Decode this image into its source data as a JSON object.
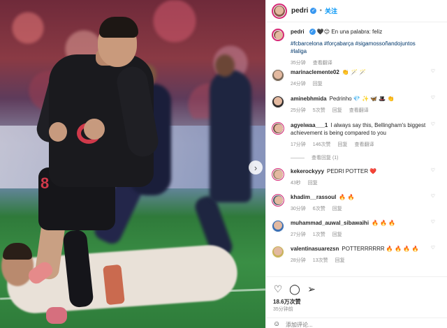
{
  "post": {
    "username": "pedri",
    "follow_label": "关注",
    "caption_text": "🖤😊 En una palabra: feliz",
    "hashtags": "#fcbarcelona #forçabarça #sigamossoñandojuntos #laliga",
    "caption_time": "35分钟",
    "caption_translate": "查看翻译",
    "jersey_number": "8",
    "likes": "18.6万次赞",
    "time_ago": "35分钟前",
    "add_comment_placeholder": "添加评论..."
  },
  "comments": [
    {
      "user": "marinaclemente02",
      "text": "👏 🪄 🪄",
      "time": "24分钟",
      "likes": "",
      "reply": "回复",
      "translate": ""
    },
    {
      "user": "aminebhmida",
      "text": "Pedrinho 💎 ✨ 🦋 🎩 👏",
      "time": "25分钟",
      "likes": "5次赞",
      "reply": "回复",
      "translate": "查看翻译"
    },
    {
      "user": "agyeiwaa___1",
      "text": "I always say this, Bellingham's biggest achievement is being compared to you",
      "time": "17分钟",
      "likes": "146次赞",
      "reply": "回复",
      "translate": "查看翻译",
      "view_replies": "查看回复 (1)"
    },
    {
      "user": "kekerockyyy",
      "text": "PEDRI POTTER ❤️",
      "time": "43秒",
      "likes": "",
      "reply": "回复",
      "translate": ""
    },
    {
      "user": "khadim__rassoul",
      "text": "🔥 🔥",
      "time": "30分钟",
      "likes": "6次赞",
      "reply": "回复",
      "translate": ""
    },
    {
      "user": "muhammad_auwal_sibawaihi",
      "text": "🔥 🔥 🔥",
      "time": "27分钟",
      "likes": "1次赞",
      "reply": "回复",
      "translate": ""
    },
    {
      "user": "valentinasuarezsn",
      "text": "POTTERRRRRR 🔥 🔥 🔥 🔥",
      "time": "28分钟",
      "likes": "13次赞",
      "reply": "回复",
      "translate": ""
    }
  ],
  "icons": {
    "like": "heart-icon",
    "comment": "comment-icon",
    "share": "send-icon",
    "emoji": "smiley-icon",
    "next": "chevron-right-icon"
  },
  "colors": {
    "accent": "#0095f6",
    "verified": "#3897f0",
    "link": "#00376b"
  }
}
